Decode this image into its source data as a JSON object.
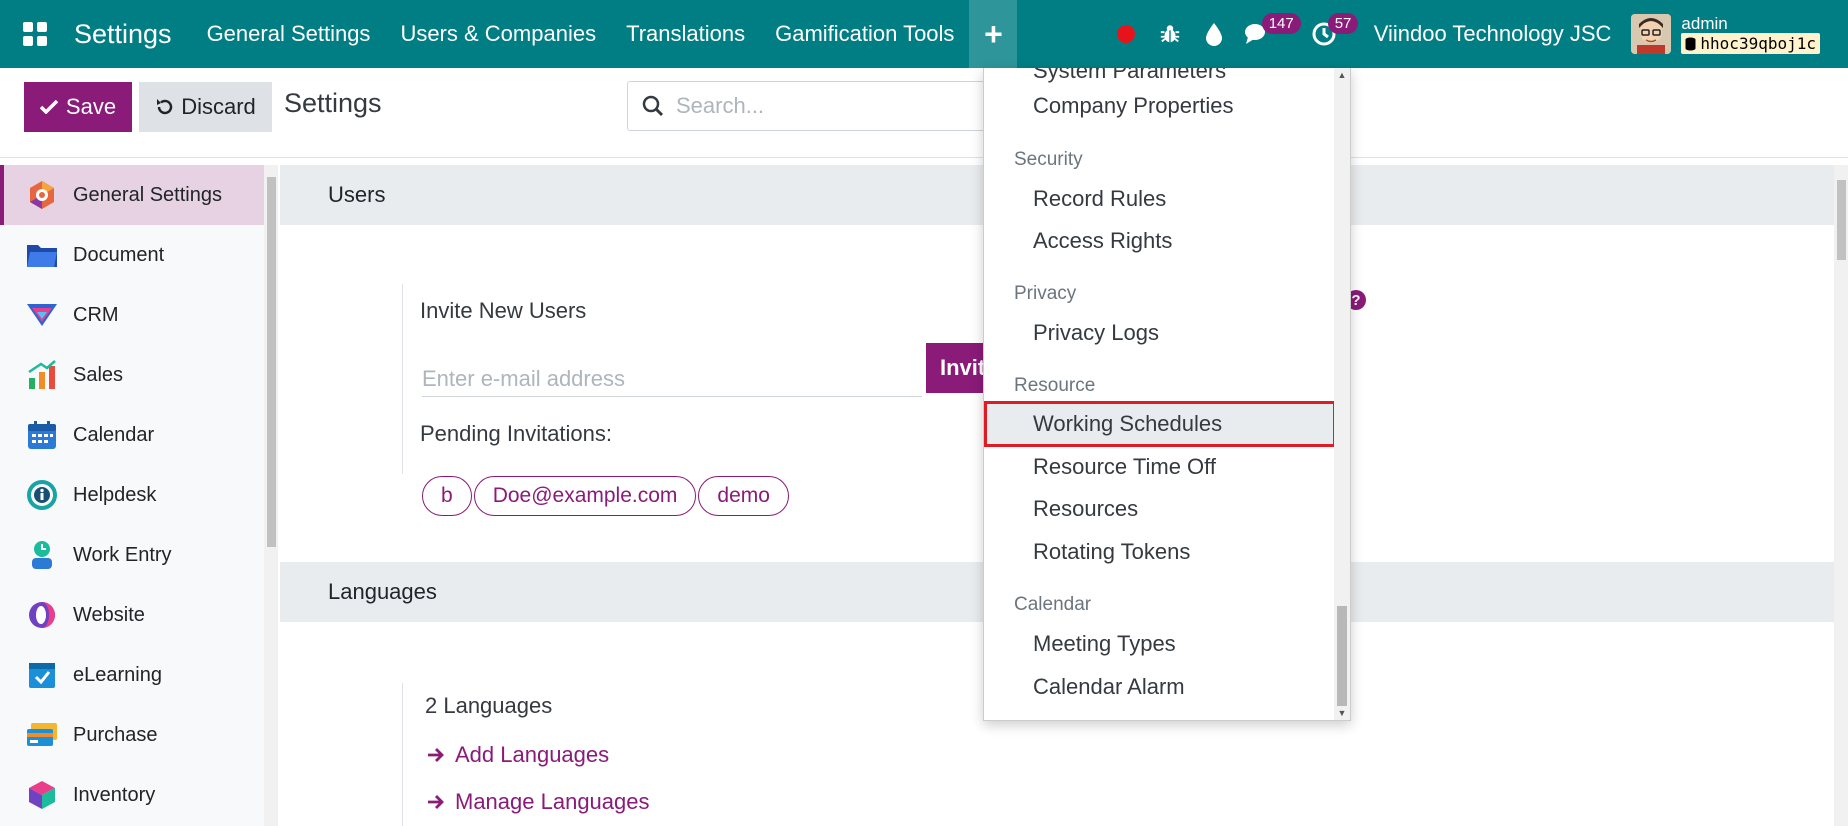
{
  "navbar": {
    "brand": "Settings",
    "menu": [
      "General Settings",
      "Users & Companies",
      "Translations",
      "Gamification Tools"
    ],
    "plus_label": "+",
    "messages_badge": "147",
    "activities_badge": "57",
    "company": "Viindoo Technology JSC",
    "user": "admin",
    "database": "hhoc39qboj1c"
  },
  "control_panel": {
    "save_label": "Save",
    "discard_label": "Discard",
    "title": "Settings",
    "search_placeholder": "Search..."
  },
  "sidebar": {
    "items": [
      {
        "label": "General Settings",
        "icon": "general-settings-icon",
        "color": "#e8663e"
      },
      {
        "label": "Document",
        "icon": "document-folder-icon",
        "color": "#2f5fc4"
      },
      {
        "label": "CRM",
        "icon": "crm-icon",
        "color": "#2e63d6"
      },
      {
        "label": "Sales",
        "icon": "sales-chart-icon",
        "color": "#f28c28"
      },
      {
        "label": "Calendar",
        "icon": "calendar-icon",
        "color": "#2b7bd6"
      },
      {
        "label": "Helpdesk",
        "icon": "helpdesk-icon",
        "color": "#19a3a5"
      },
      {
        "label": "Work Entry",
        "icon": "work-entry-icon",
        "color": "#1aa0c5"
      },
      {
        "label": "Website",
        "icon": "website-icon",
        "color": "#6f42c1"
      },
      {
        "label": "eLearning",
        "icon": "elearning-icon",
        "color": "#1c8fd9"
      },
      {
        "label": "Purchase",
        "icon": "purchase-card-icon",
        "color": "#f2b632"
      },
      {
        "label": "Inventory",
        "icon": "inventory-box-icon",
        "color": "#d63a6b"
      }
    ]
  },
  "main": {
    "users_section": "Users",
    "invite_label": "Invite New Users",
    "email_placeholder": "Enter e-mail address",
    "invite_button": "Invite",
    "pending_label": "Pending Invitations:",
    "pending": [
      "b",
      "Doe@example.com",
      "demo"
    ],
    "languages_section": "Languages",
    "languages_count": "2 Languages",
    "add_languages": "Add Languages",
    "manage_languages": "Manage Languages"
  },
  "dropdown": {
    "partial_top": "System Parameters",
    "company_properties": "Company Properties",
    "security_header": "Security",
    "record_rules": "Record Rules",
    "access_rights": "Access Rights",
    "privacy_header": "Privacy",
    "privacy_logs": "Privacy Logs",
    "resource_header": "Resource",
    "working_schedules": "Working Schedules",
    "resource_time_off": "Resource Time Off",
    "resources": "Resources",
    "rotating_tokens": "Rotating Tokens",
    "calendar_header": "Calendar",
    "meeting_types": "Meeting Types",
    "calendar_alarm": "Calendar Alarm"
  },
  "colors": {
    "navbar": "#017e84",
    "primary": "#8a1b79",
    "highlight_border": "#e01b24"
  }
}
